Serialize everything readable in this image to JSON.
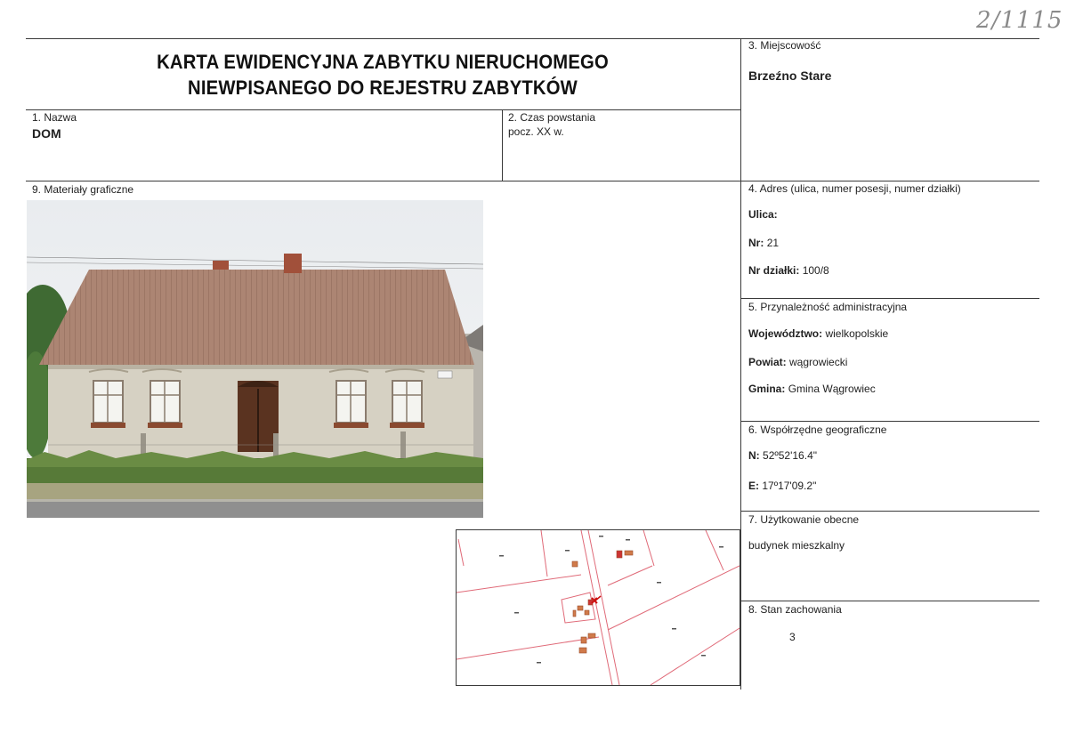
{
  "archive_number": "2/1115",
  "title_line1": "KARTA EWIDENCYJNA ZABYTKU NIERUCHOMEGO",
  "title_line2": "NIEWPISANEGO DO REJESTRU ZABYTKÓW",
  "field1": {
    "label": "1. Nazwa",
    "value": "DOM"
  },
  "field2": {
    "label": "2. Czas powstania",
    "value": "pocz. XX w."
  },
  "field3": {
    "label": "3. Miejscowość",
    "value": "Brzeźno Stare"
  },
  "field4": {
    "label": "4. Adres (ulica, numer posesji, numer działki)",
    "street_label": "Ulica:",
    "street_value": "",
    "nr_label": "Nr:",
    "nr_value": "21",
    "plot_label": "Nr działki:",
    "plot_value": "100/8"
  },
  "field5": {
    "label": "5. Przynależność administracyjna",
    "voiv_label": "Województwo:",
    "voiv_value": "wielkopolskie",
    "county_label": "Powiat:",
    "county_value": "wągrowiecki",
    "commune_label": "Gmina:",
    "commune_value": "Gmina Wągrowiec"
  },
  "field6": {
    "label": "6. Współrzędne geograficzne",
    "n_label": "N:",
    "n_value": "52º52'16.4\"",
    "e_label": "E:",
    "e_value": "17º17'09.2\""
  },
  "field7": {
    "label": "7. Użytkowanie obecne",
    "value": "budynek mieszkalny"
  },
  "field8": {
    "label": "8. Stan zachowania",
    "value": "3"
  },
  "field9": {
    "label": "9. Materiały graficzne"
  },
  "colors": {
    "border": "#3a3a3a",
    "map_line": "#e06a78",
    "building": "#d07a4a",
    "marker": "#cc1111"
  }
}
